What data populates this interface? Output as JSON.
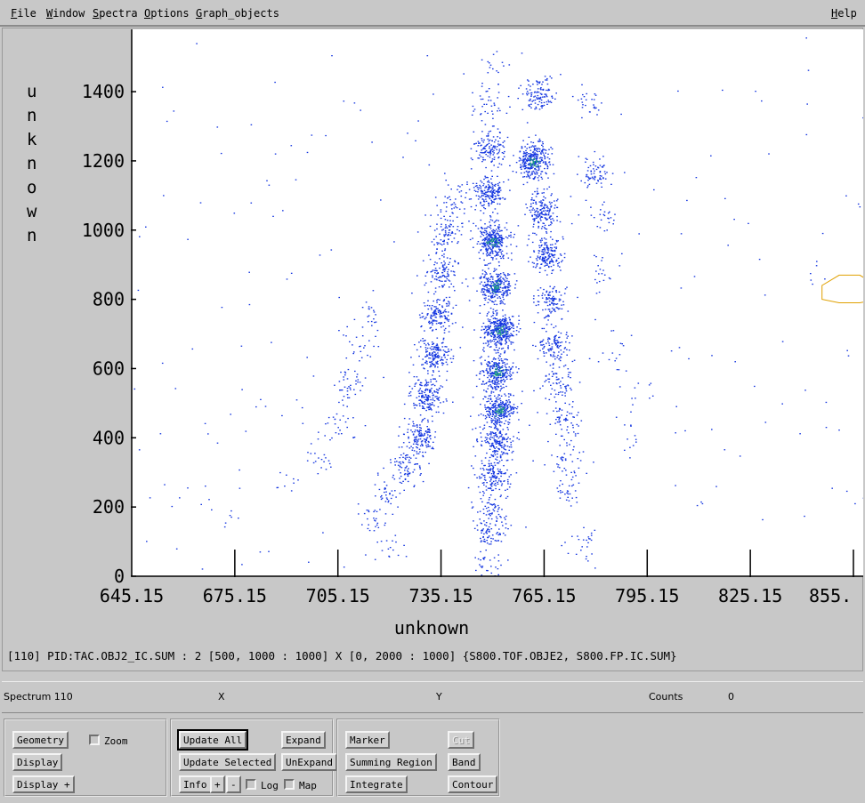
{
  "menu": {
    "file": {
      "first": "F",
      "rest": "ile"
    },
    "window": {
      "first": "W",
      "rest": "indow"
    },
    "spectra": {
      "first": "S",
      "rest": "pectra"
    },
    "options": {
      "first": "O",
      "rest": "ptions"
    },
    "graph_objects": {
      "first": "G",
      "rest": "raph_objects"
    },
    "help": {
      "first": "H",
      "rest": "elp"
    }
  },
  "plot": {
    "ylabel_letters": [
      "u",
      "n",
      "k",
      "n",
      "o",
      "w",
      "n"
    ],
    "xlabel": "unknown",
    "description": "[110] PID:TAC.OBJ2_IC.SUM : 2 [500, 1000 : 1000] X [0, 2000 : 1000] {S800.TOF.OBJE2, S800.FP.IC.SUM}"
  },
  "chart_data": {
    "type": "scatter",
    "x_ticks": [
      "645.15",
      "675.15",
      "705.15",
      "735.15",
      "765.15",
      "795.15",
      "825.15",
      "855."
    ],
    "y_ticks": [
      "0",
      "200",
      "400",
      "600",
      "800",
      "1000",
      "1200",
      "1400"
    ],
    "xlim": [
      645.15,
      858
    ],
    "ylim": [
      0,
      1580
    ],
    "xlabel": "unknown",
    "ylabel": "unknown",
    "point_color": "#1436e0",
    "dense_color": "#20a080",
    "gate_color": "#e0a000",
    "clusters": [
      {
        "x": 673,
        "y": 180,
        "n": 6
      },
      {
        "x": 690,
        "y": 265,
        "n": 8
      },
      {
        "x": 700,
        "y": 350,
        "n": 20
      },
      {
        "x": 706,
        "y": 440,
        "n": 25
      },
      {
        "x": 708,
        "y": 560,
        "n": 40
      },
      {
        "x": 711,
        "y": 660,
        "n": 20
      },
      {
        "x": 713,
        "y": 750,
        "n": 20
      },
      {
        "x": 716,
        "y": 160,
        "n": 25
      },
      {
        "x": 719,
        "y": 240,
        "n": 40
      },
      {
        "x": 720,
        "y": 80,
        "n": 15
      },
      {
        "x": 725,
        "y": 320,
        "n": 80
      },
      {
        "x": 729,
        "y": 410,
        "n": 140
      },
      {
        "x": 731,
        "y": 525,
        "n": 170
      },
      {
        "x": 733,
        "y": 640,
        "n": 170
      },
      {
        "x": 734,
        "y": 760,
        "n": 140
      },
      {
        "x": 735,
        "y": 880,
        "n": 110
      },
      {
        "x": 737,
        "y": 1000,
        "n": 80
      },
      {
        "x": 739,
        "y": 1090,
        "n": 40
      },
      {
        "x": 748,
        "y": 40,
        "n": 30
      },
      {
        "x": 749,
        "y": 130,
        "n": 70
      },
      {
        "x": 750,
        "y": 200,
        "n": 60
      },
      {
        "x": 750,
        "y": 290,
        "n": 140
      },
      {
        "x": 751,
        "y": 390,
        "n": 170
      },
      {
        "x": 752,
        "y": 480,
        "n": 280
      },
      {
        "x": 751,
        "y": 590,
        "n": 260
      },
      {
        "x": 752,
        "y": 710,
        "n": 360
      },
      {
        "x": 751,
        "y": 840,
        "n": 280
      },
      {
        "x": 750,
        "y": 970,
        "n": 300
      },
      {
        "x": 749,
        "y": 1110,
        "n": 190
      },
      {
        "x": 749,
        "y": 1240,
        "n": 130
      },
      {
        "x": 749,
        "y": 1370,
        "n": 40
      },
      {
        "x": 750,
        "y": 1480,
        "n": 15
      },
      {
        "x": 762,
        "y": 1200,
        "n": 300
      },
      {
        "x": 763,
        "y": 1390,
        "n": 110
      },
      {
        "x": 764,
        "y": 1060,
        "n": 170
      },
      {
        "x": 766,
        "y": 930,
        "n": 170
      },
      {
        "x": 767,
        "y": 790,
        "n": 110
      },
      {
        "x": 768,
        "y": 670,
        "n": 110
      },
      {
        "x": 769,
        "y": 560,
        "n": 70
      },
      {
        "x": 771,
        "y": 460,
        "n": 60
      },
      {
        "x": 771,
        "y": 340,
        "n": 40
      },
      {
        "x": 772,
        "y": 250,
        "n": 30
      },
      {
        "x": 777,
        "y": 110,
        "n": 25
      },
      {
        "x": 778,
        "y": 1370,
        "n": 25
      },
      {
        "x": 780,
        "y": 1170,
        "n": 70
      },
      {
        "x": 781,
        "y": 1040,
        "n": 25
      },
      {
        "x": 782,
        "y": 880,
        "n": 20
      },
      {
        "x": 786,
        "y": 660,
        "n": 15
      },
      {
        "x": 793,
        "y": 520,
        "n": 10
      },
      {
        "x": 791,
        "y": 400,
        "n": 10
      }
    ],
    "gate_polygon": [
      [
        851,
        790
      ],
      [
        846,
        800
      ],
      [
        846,
        840
      ],
      [
        851,
        870
      ],
      [
        857,
        870
      ],
      [
        862,
        840
      ],
      [
        862,
        800
      ],
      [
        857,
        790
      ]
    ]
  },
  "status": {
    "spectrum": "Spectrum 110",
    "x_label": "X",
    "y_label": "Y",
    "counts_label": "Counts",
    "counts_value": "0"
  },
  "controls": {
    "geometry": "Geometry",
    "zoom": "Zoom",
    "display": "Display",
    "display_plus": "Display +",
    "update_all": "Update All",
    "expand": "Expand",
    "update_selected": "Update Selected",
    "unexpand": "UnExpand",
    "info": "Info",
    "plus": "+",
    "minus": "-",
    "log": "Log",
    "map": "Map",
    "marker": "Marker",
    "cut": "Cut",
    "summing_region": "Summing Region",
    "band": "Band",
    "integrate": "Integrate",
    "contour": "Contour"
  }
}
